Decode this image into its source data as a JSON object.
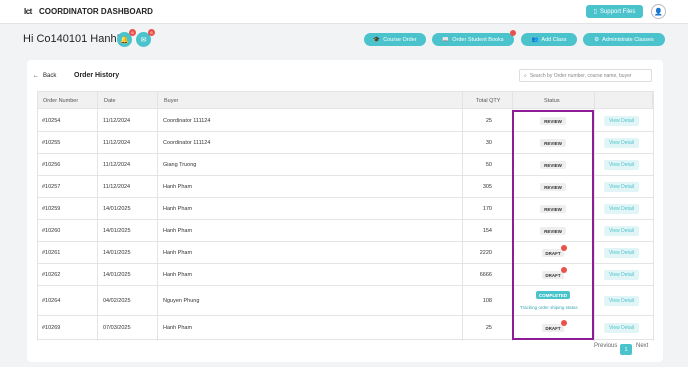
{
  "header": {
    "logo_text": "Ict",
    "title": "COORDINATOR DASHBOARD",
    "support_label": "Support Files"
  },
  "greeting": "Hi Co140101 Hanh!",
  "bell_count": "6",
  "mail_count": "6",
  "actions": {
    "course_order": "Course Order",
    "order_books": "Order Student Books",
    "add_class": "Add Class",
    "admin_classes": "Administrate Classes"
  },
  "page": {
    "back_label": "Back",
    "title": "Order History",
    "search_placeholder": "Search by Order number, course name, buyer"
  },
  "table": {
    "columns": [
      "Order Number",
      "Date",
      "Buyer",
      "Total QTY",
      "Status"
    ],
    "view_label": "View Detail",
    "rows": [
      {
        "order": "#10254",
        "date": "11/12/2024",
        "buyer": "Coordinator 111124",
        "qty": "25",
        "status": "REVIEW"
      },
      {
        "order": "#10255",
        "date": "11/12/2024",
        "buyer": "Coordinator 111124",
        "qty": "30",
        "status": "REVIEW"
      },
      {
        "order": "#10256",
        "date": "11/12/2024",
        "buyer": "Giang Truong",
        "qty": "50",
        "status": "REVIEW"
      },
      {
        "order": "#10257",
        "date": "11/12/2024",
        "buyer": "Hanh Pham",
        "qty": "305",
        "status": "REVIEW"
      },
      {
        "order": "#10259",
        "date": "14/01/2025",
        "buyer": "Hanh Pham",
        "qty": "170",
        "status": "REVIEW"
      },
      {
        "order": "#10260",
        "date": "14/01/2025",
        "buyer": "Hanh Pham",
        "qty": "154",
        "status": "REVIEW"
      },
      {
        "order": "#10261",
        "date": "14/01/2025",
        "buyer": "Hanh Pham",
        "qty": "2220",
        "status": "DRAFT"
      },
      {
        "order": "#10262",
        "date": "14/01/2025",
        "buyer": "Hanh Pham",
        "qty": "6666",
        "status": "DRAFT"
      },
      {
        "order": "#10264",
        "date": "04/02/2025",
        "buyer": "Nguyen Phung",
        "qty": "108",
        "status": "COMPLETED",
        "tracking": "Tracking order shiping status"
      },
      {
        "order": "#10269",
        "date": "07/03/2025",
        "buyer": "Hanh Pham",
        "qty": "25",
        "status": "DRAFT"
      }
    ]
  },
  "pagination": {
    "previous": "Previous",
    "page": "1",
    "next": "Next"
  }
}
